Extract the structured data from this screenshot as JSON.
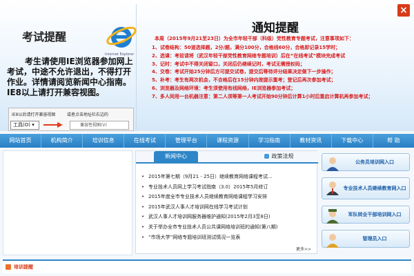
{
  "close_label": "×",
  "exam_notice": {
    "title": "考试提醒",
    "ie_caption": "Internet Explorer",
    "body": "考生请使用IE浏览器参加网上考试，中途不允许退出，不得打开作业。详情请阅览新闻中心指南。IE8以上请打开兼容视图。",
    "ie_strip": {
      "hint_left": "IE8以后请打开兼容视图",
      "hint_right": "或者点击地址栏右边的",
      "tools_label": "工具(O) ▾",
      "compat_label": "兼容性视图(V)"
    }
  },
  "notice": {
    "title": "通知提醒",
    "lead": "本周（2015年9月21至23日）为全市年轻干部（科级）党性教育专题考试，注意事项如下：",
    "items": [
      "1、试卷结构：50道选择题，2分/题，满分100分，合格线60分，合格即记录15学时；",
      "2、选课：考前请将（武汉年轻干部党性教育网络专题培训）后在“在线考试”模块完成考试",
      "3、记时：考试中不得关闭窗口，关闭后仍继续记时，考试无需授权码；",
      "4、交卷：考试开始25分钟后方可提交试卷，提交后等待评分结果决定做下一步操作；",
      "5、补考：考生有两次机会，不合格后在15分钟内按提示重考；登记后再次参加考试；",
      "6、浏览器及网络环境：考生须使用有线网络，IE浏览器参加考试；",
      "7、多人同用一台机器注意：第二人须等第一人考试开始90分钟后计算1小时后重启计算机再参加考试；"
    ]
  },
  "nav": [
    "网站首页",
    "机构简介",
    "培训信息",
    "在线考试",
    "管理平台",
    "课程资源",
    "学习指南",
    "教材资讯",
    "下载中心",
    "帮 助"
  ],
  "news": {
    "tab_active": "新闻中心",
    "tab_policy": "政策法规",
    "items": [
      "2015年第七期（9月21 - 25日）继续教育网络课程考试...",
      "专业技术人员网上学习考试指南（3.0）2015年5月修订",
      "2015年度全市专业技术人员继续教育网络课程学习安排",
      "2015年武汉人事人才培训网在线学习考试计划",
      "武汉人事人才培训网服务器维护通知(2015年2月3至8日)",
      "关于举办全市专业技术人员公共课网络培训班的通知(第八期)",
      "“市场大学”网络专题培训班测试情况一览表"
    ],
    "more": "更多>>"
  },
  "entries": [
    {
      "label": "公务员培训网入口",
      "icon": "civil-servant-avatar-icon"
    },
    {
      "label": "专业技术人员继续教育网入口",
      "icon": "professional-avatar-icon"
    },
    {
      "label": "军队转业干部培训网入口",
      "icon": "military-avatar-icon"
    },
    {
      "label": "管理员入口",
      "icon": "admin-avatar-icon"
    }
  ],
  "bottom": {
    "label": "培训提醒"
  },
  "colors": {
    "nav_bg": "#2a7fc4",
    "notice_red": "#d81a1a",
    "tab_active": "#2e86c8",
    "close_red": "#d83b1a"
  }
}
